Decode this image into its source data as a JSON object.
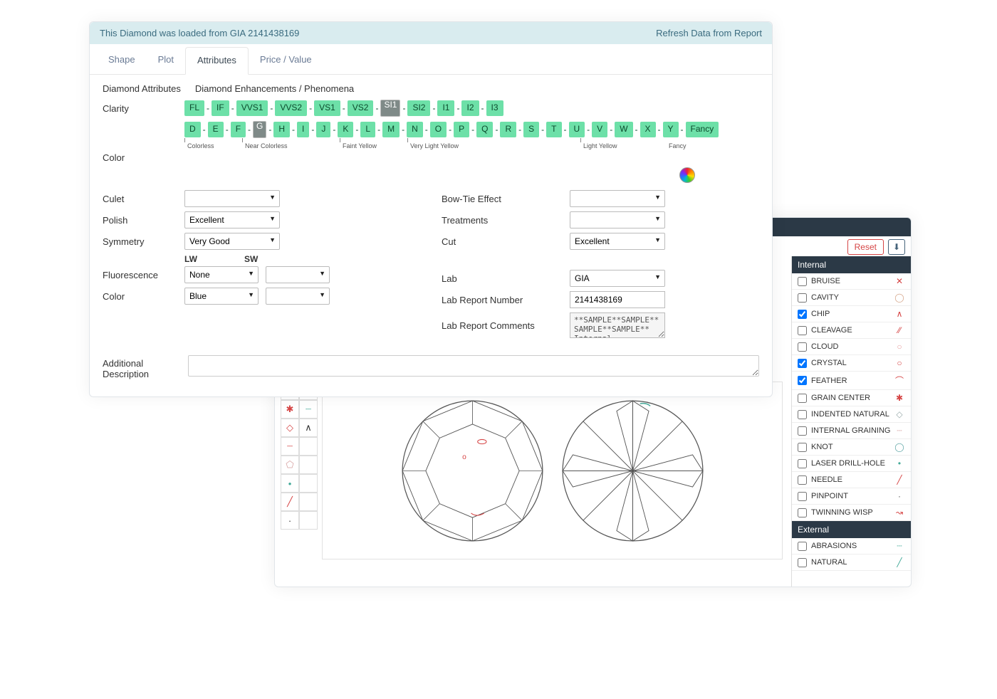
{
  "banner": {
    "message": "This Diamond was loaded from GIA 2141438169",
    "refresh_link": "Refresh Data from Report"
  },
  "tabs": [
    "Shape",
    "Plot",
    "Attributes",
    "Price / Value"
  ],
  "active_tab": "Attributes",
  "subtabs": [
    "Diamond Attributes",
    "Diamond Enhancements / Phenomena"
  ],
  "labels": {
    "clarity": "Clarity",
    "color": "Color",
    "culet": "Culet",
    "polish": "Polish",
    "symmetry": "Symmetry",
    "bowtie": "Bow-Tie Effect",
    "treatments": "Treatments",
    "cut": "Cut",
    "lw": "LW",
    "sw": "SW",
    "fluorescence": "Fluorescence",
    "fl_color": "Color",
    "lab": "Lab",
    "lab_report_number": "Lab Report Number",
    "lab_report_comments": "Lab Report Comments",
    "additional_description": "Additional Description"
  },
  "clarity_scale": [
    "FL",
    "-",
    "IF",
    "-",
    "VVS1",
    "-",
    "VVS2",
    "-",
    "VS1",
    "-",
    "VS2",
    "-",
    "SI1",
    "-",
    "SI2",
    "-",
    "I1",
    "-",
    "I2",
    "-",
    "I3"
  ],
  "clarity_selected": "SI1",
  "color_scale": [
    "D",
    "-",
    "E",
    "-",
    "F",
    "-",
    "G",
    "-",
    "H",
    "-",
    "I",
    "-",
    "J",
    "-",
    "K",
    "-",
    "L",
    "-",
    "M",
    "-",
    "N",
    "-",
    "O",
    "-",
    "P",
    "-",
    "Q",
    "-",
    "R",
    "-",
    "S",
    "-",
    "T",
    "-",
    "U",
    "-",
    "V",
    "-",
    "W",
    "-",
    "X",
    "-",
    "Y",
    "-",
    "Fancy"
  ],
  "color_selected": "G",
  "color_axis": [
    "Colorless",
    "Near Colorless",
    "Faint Yellow",
    "Very Light Yellow",
    "Light Yellow",
    "Fancy"
  ],
  "values": {
    "culet": "",
    "polish": "Excellent",
    "symmetry": "Very Good",
    "bowtie": "",
    "treatments": "",
    "cut": "Excellent",
    "fl_lw": "None",
    "fl_sw": "",
    "fl_color_lw": "Blue",
    "fl_color_sw": "",
    "lab": "GIA",
    "lab_report_number": "2141438169",
    "lab_report_comments": "**SAMPLE**SAMPLE**SAMPLE**SAMPLE** Internal",
    "additional_description": ""
  },
  "plot_panel": {
    "reset_label": "Reset",
    "sections": {
      "internal": "Internal",
      "external": "External"
    },
    "internal": [
      {
        "name": "BRUISE",
        "checked": false,
        "sym": "✕",
        "color": "#d64545"
      },
      {
        "name": "CAVITY",
        "checked": false,
        "sym": "◯",
        "color": "#d6a78b"
      },
      {
        "name": "CHIP",
        "checked": true,
        "sym": "∧",
        "color": "#d64545"
      },
      {
        "name": "CLEAVAGE",
        "checked": false,
        "sym": "⁄⁄",
        "color": "#d64545"
      },
      {
        "name": "CLOUD",
        "checked": false,
        "sym": "○",
        "color": "#e7a0a0"
      },
      {
        "name": "CRYSTAL",
        "checked": true,
        "sym": "○",
        "color": "#d64545"
      },
      {
        "name": "FEATHER",
        "checked": true,
        "sym": "⌒",
        "color": "#d64545"
      },
      {
        "name": "GRAIN CENTER",
        "checked": false,
        "sym": "✱",
        "color": "#d64545"
      },
      {
        "name": "INDENTED NATURAL",
        "checked": false,
        "sym": "◇",
        "color": "#9aa"
      },
      {
        "name": "INTERNAL GRAINING",
        "checked": false,
        "sym": "┈",
        "color": "#d6a0a0"
      },
      {
        "name": "KNOT",
        "checked": false,
        "sym": "◯",
        "color": "#6aa"
      },
      {
        "name": "LASER DRILL-HOLE",
        "checked": false,
        "sym": "•",
        "color": "#4a9"
      },
      {
        "name": "NEEDLE",
        "checked": false,
        "sym": "╱",
        "color": "#d64545"
      },
      {
        "name": "PINPOINT",
        "checked": false,
        "sym": "·",
        "color": "#555"
      },
      {
        "name": "TWINNING WISP",
        "checked": false,
        "sym": "↝",
        "color": "#d64545"
      }
    ],
    "external": [
      {
        "name": "ABRASIONS",
        "checked": false,
        "sym": "┈",
        "color": "#4a9"
      },
      {
        "name": "NATURAL",
        "checked": false,
        "sym": "╱",
        "color": "#4a9"
      }
    ]
  }
}
